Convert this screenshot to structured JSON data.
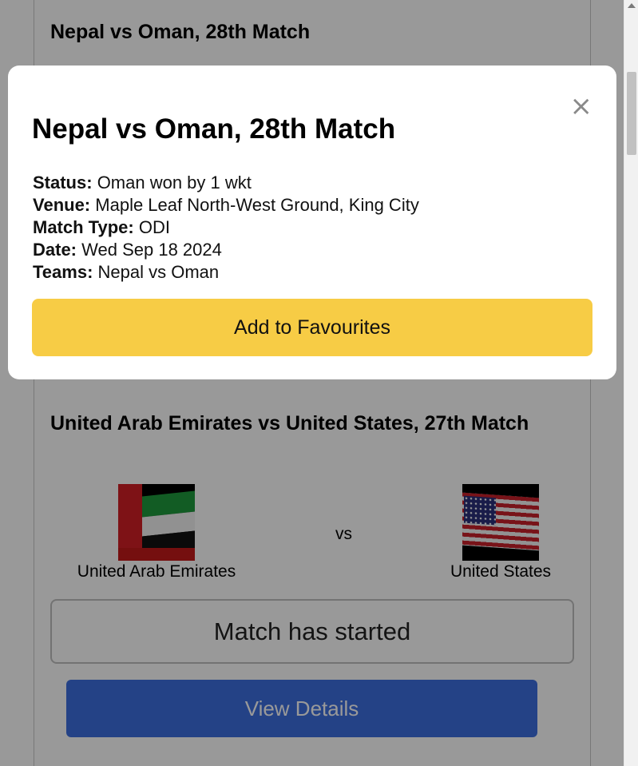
{
  "background_cards": {
    "top_card_title": "Nepal vs Oman, 28th Match",
    "second_card": {
      "title": "United Arab Emirates vs United States, 27th Match",
      "team_a": {
        "name": "United Arab Emirates",
        "flag_icon": "uae-flag-icon"
      },
      "vs_label": "vs",
      "team_b": {
        "name": "United States",
        "flag_icon": "us-flag-icon"
      },
      "status_text": "Match has started",
      "view_details_label": "View Details"
    }
  },
  "modal": {
    "close_symbol": "×",
    "title": "Nepal vs Oman, 28th Match",
    "details": [
      {
        "label": "Status:",
        "value": "Oman won by 1 wkt"
      },
      {
        "label": "Venue:",
        "value": "Maple Leaf North-West Ground, King City"
      },
      {
        "label": "Match Type:",
        "value": "ODI"
      },
      {
        "label": "Date:",
        "value": "Wed Sep 18 2024"
      },
      {
        "label": "Teams:",
        "value": "Nepal vs Oman"
      }
    ],
    "favourite_button_label": "Add to Favourites"
  },
  "colors": {
    "favourite_button": "#f7cc45",
    "view_details_button": "#3d6ee0",
    "backdrop": "rgba(0,0,0,0.4)"
  }
}
